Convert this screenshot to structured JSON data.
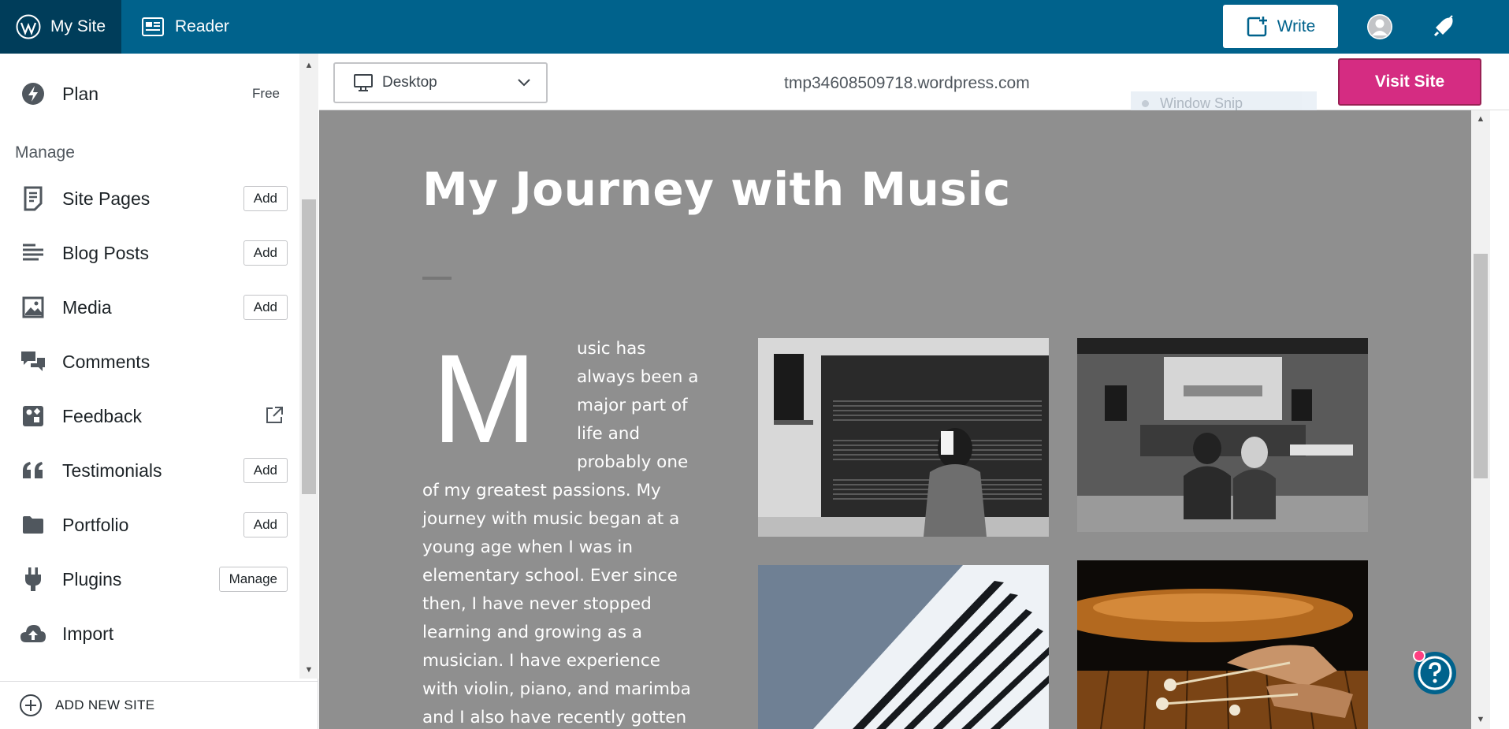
{
  "topbar": {
    "my_site_label": "My Site",
    "reader_label": "Reader",
    "write_label": "Write",
    "brand_color": "#00628c",
    "brand_dark_color": "#003d5a"
  },
  "sidebar": {
    "plan": {
      "label": "Plan",
      "badge": "Free",
      "icon": "plan-bolt-icon"
    },
    "section_title": "Manage",
    "items": [
      {
        "label": "Site Pages",
        "button": "Add",
        "icon": "page-icon"
      },
      {
        "label": "Blog Posts",
        "button": "Add",
        "icon": "posts-icon"
      },
      {
        "label": "Media",
        "button": "Add",
        "icon": "media-icon"
      },
      {
        "label": "Comments",
        "button": "",
        "icon": "comments-icon"
      },
      {
        "label": "Feedback",
        "button": "",
        "icon": "feedback-icon"
      },
      {
        "label": "Testimonials",
        "button": "Add",
        "icon": "quote-icon"
      },
      {
        "label": "Portfolio",
        "button": "Add",
        "icon": "folder-icon"
      },
      {
        "label": "Plugins",
        "button": "Manage",
        "icon": "plug-icon"
      },
      {
        "label": "Import",
        "button": "",
        "icon": "cloud-upload-icon"
      }
    ],
    "add_new_site": "ADD NEW SITE"
  },
  "preview_toolbar": {
    "device": "Desktop",
    "site_url": "tmp34608509718.wordpress.com",
    "overlay_text": "Window Snip",
    "visit_site": "Visit Site",
    "visit_color": "#d52c82"
  },
  "post": {
    "title": "My Journey with Music",
    "dropcap": "M",
    "lines_indented": [
      "usic has",
      "always been a",
      "major part of",
      "life and",
      "probably one"
    ],
    "lines_full": [
      "of my greatest passions. My",
      "journey with music began at a",
      "young age when I was in",
      "elementary school. Ever since",
      "then, I have never stopped",
      "learning and growing as a",
      "musician. I have experience",
      "with violin, piano, and marimba",
      "and I also have recently gotten"
    ],
    "background_color": "#8f8f8f"
  }
}
